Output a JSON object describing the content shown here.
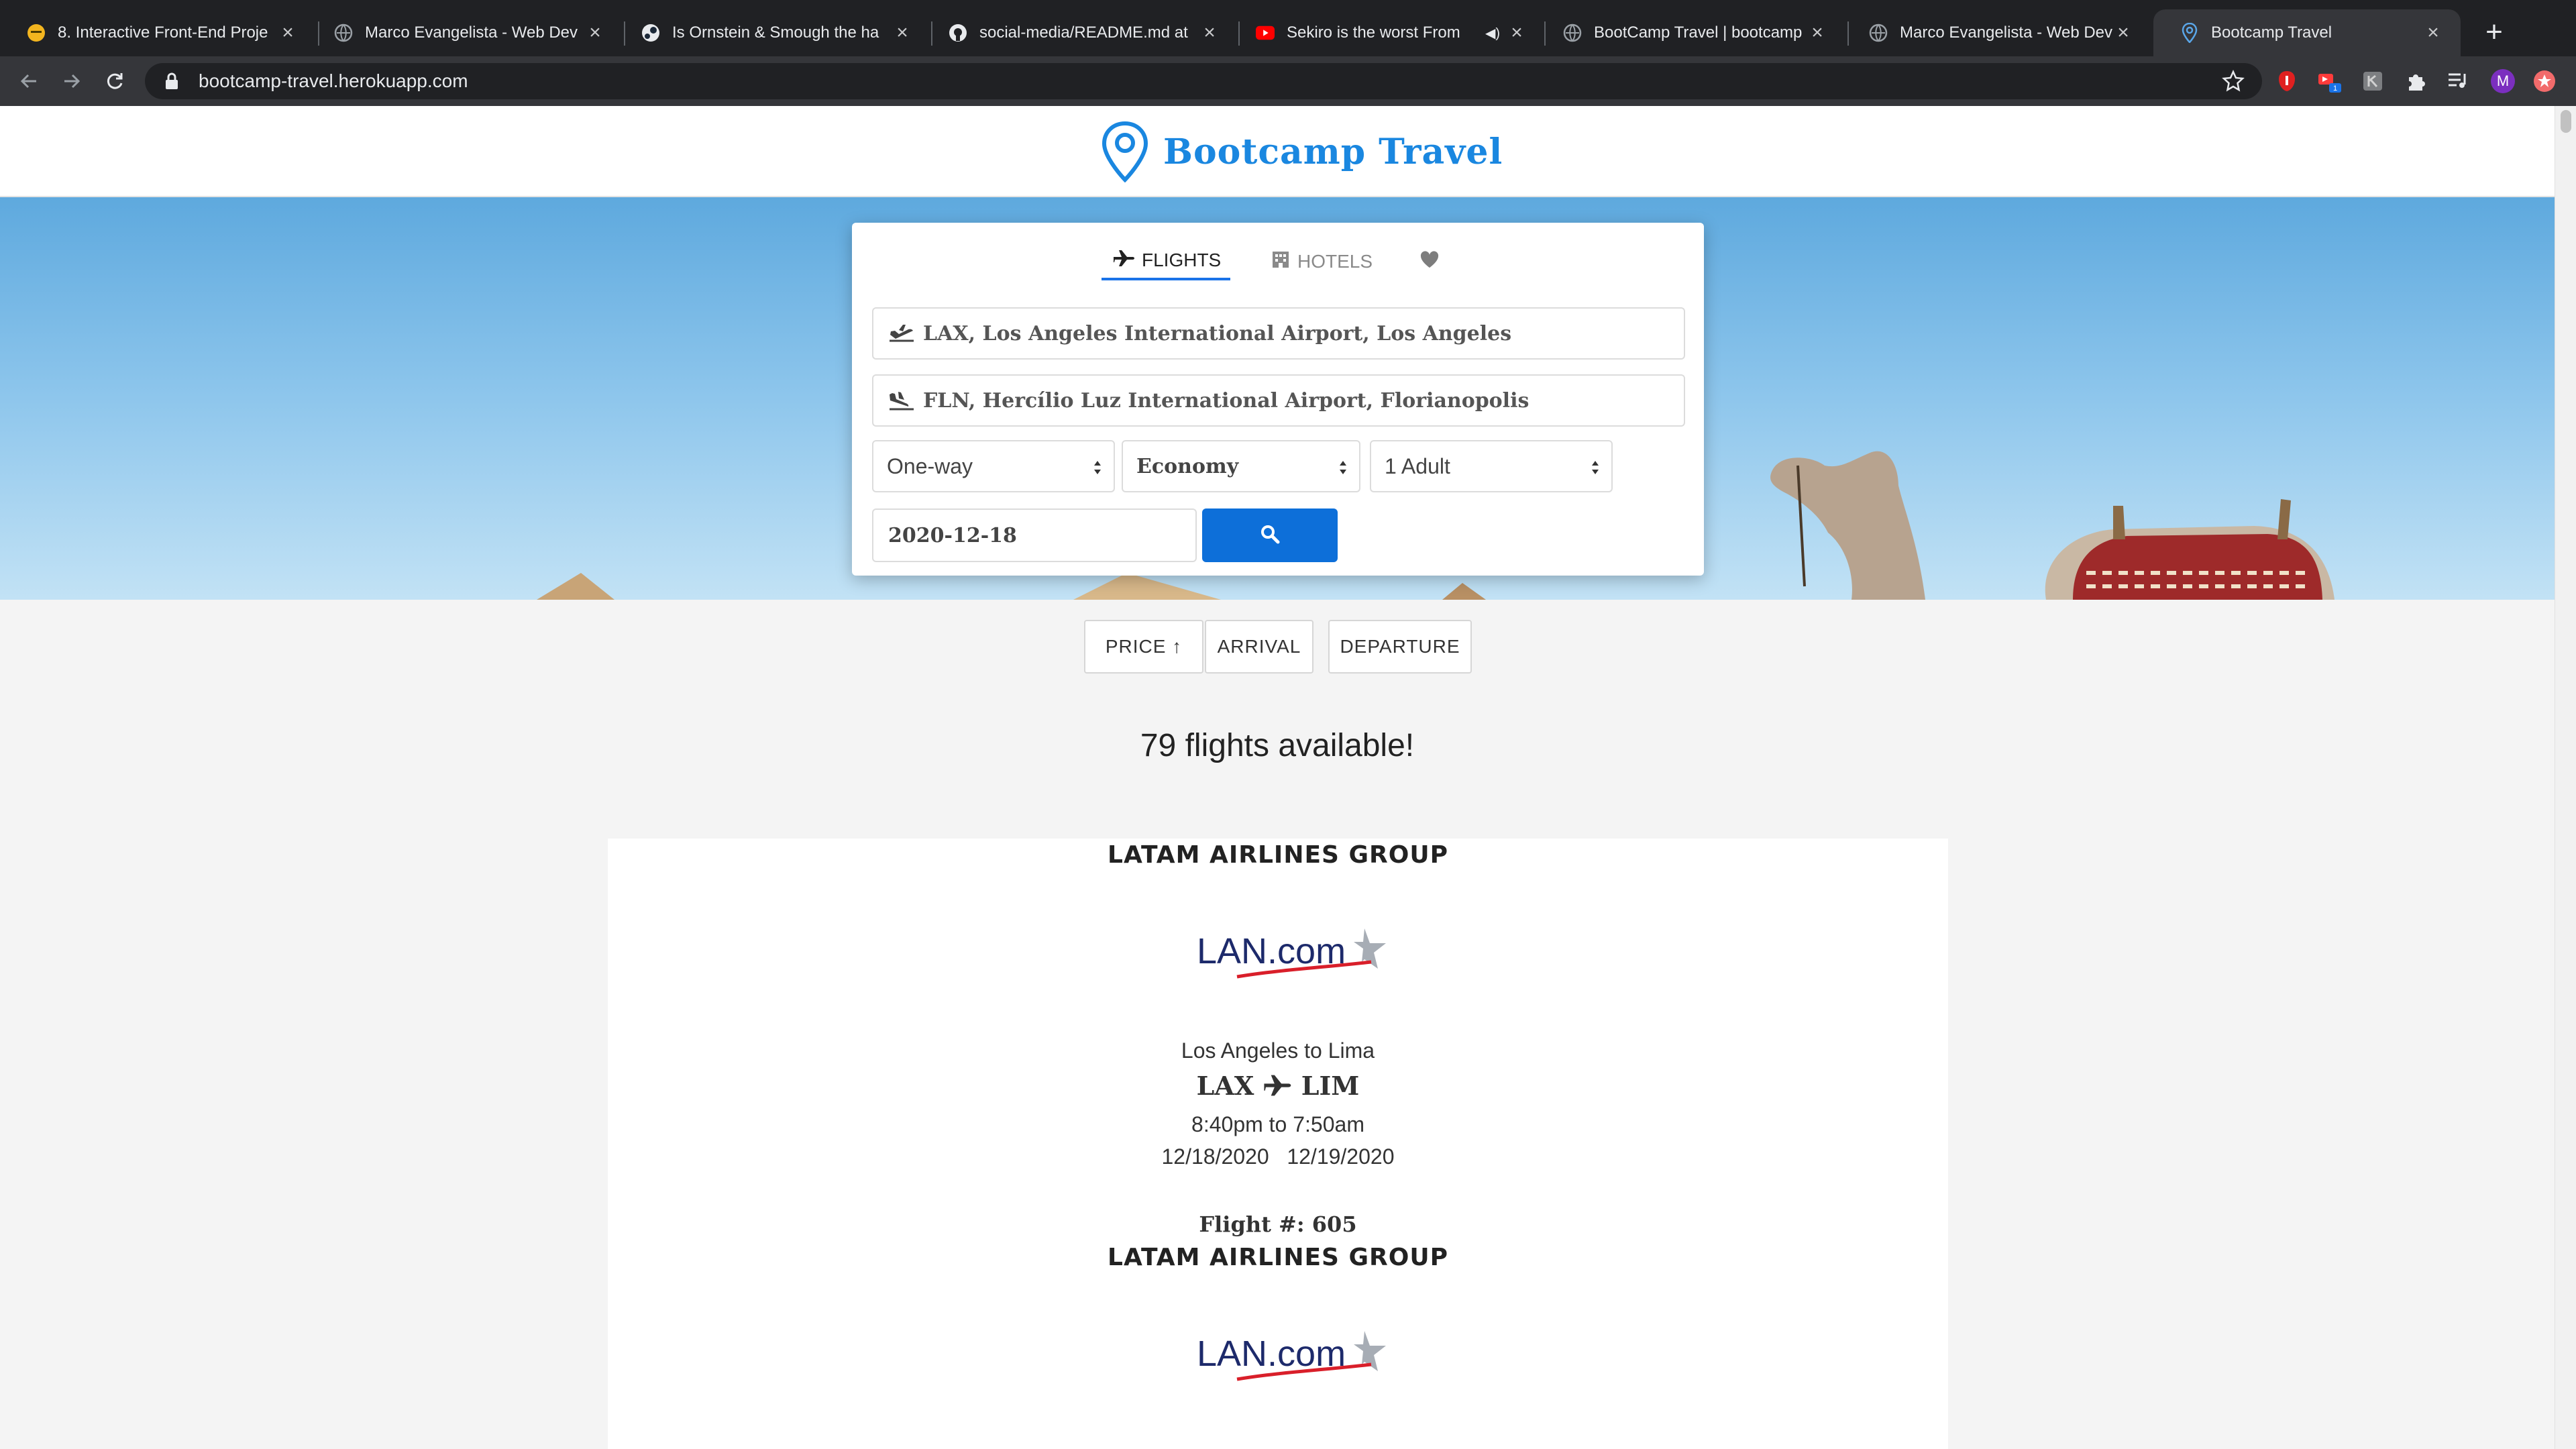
{
  "browser": {
    "tabs": [
      {
        "title": "8. Interactive Front-End Proje",
        "favicon": "yellow-emoji-icon",
        "active": false
      },
      {
        "title": "Marco Evangelista - Web Dev",
        "favicon": "globe-icon",
        "active": false
      },
      {
        "title": "Is Ornstein & Smough the ha",
        "favicon": "steam-icon",
        "active": false
      },
      {
        "title": "social-media/README.md at",
        "favicon": "github-icon",
        "active": false
      },
      {
        "title": "Sekiro is the worst From",
        "favicon": "youtube-icon",
        "active": false
      },
      {
        "title": "BootCamp Travel | bootcamp",
        "favicon": "globe-icon",
        "active": false
      },
      {
        "title": "Marco Evangelista - Web Dev",
        "favicon": "globe-icon",
        "active": false
      },
      {
        "title": "Bootcamp Travel",
        "favicon": "map-pin-icon",
        "active": true
      }
    ],
    "url": "bootcamp-travel.herokuapp.com",
    "profile_initial": "M",
    "extension_badge": "1"
  },
  "site": {
    "brand": "Bootcamp Travel",
    "brand_color": "#1a87e0"
  },
  "search": {
    "tabs": {
      "flights": "FLIGHTS",
      "hotels": "HOTELS"
    },
    "origin": "LAX, Los Angeles International Airport, Los Angeles",
    "destination": "FLN, Hercílio Luz International Airport, Florianopolis",
    "trip_type": "One-way",
    "cabin_class": "Economy",
    "passengers": "1 Adult",
    "date": "2020-12-18",
    "button_color": "#0d6fd9"
  },
  "sort": {
    "price": "PRICE ↑",
    "arrival": "ARRIVAL",
    "departure": "DEPARTURE"
  },
  "results": {
    "count_text": "79 flights available!",
    "flights": [
      {
        "airline": "LATAM AIRLINES GROUP",
        "logo_text": "LAN.com",
        "route": "Los Angeles to Lima",
        "from_code": "LAX",
        "to_code": "LIM",
        "times": "8:40pm to 7:50am",
        "dates": "12/18/2020   12/19/2020",
        "flight_number": "Flight #: 605"
      },
      {
        "airline": "LATAM AIRLINES GROUP",
        "logo_text": "LAN.com"
      }
    ]
  }
}
